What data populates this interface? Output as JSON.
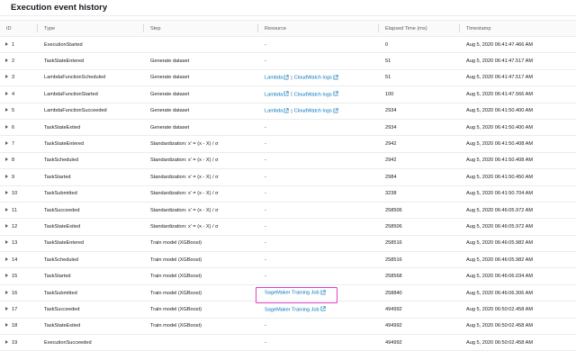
{
  "panel": {
    "title": "Execution event history"
  },
  "columns": [
    "ID",
    "Type",
    "Step",
    "Resource",
    "Elapsed Time (ms)",
    "Timestamp"
  ],
  "rows": [
    {
      "id": "1",
      "type": "ExecutionStarted",
      "step": "",
      "resource": {
        "kind": "dash",
        "text": "-"
      },
      "elapsed": "0",
      "timestamp": "Aug 5, 2020 06:41:47.466 AM"
    },
    {
      "id": "2",
      "type": "TaskStateEntered",
      "step": "Generate dataset",
      "resource": {
        "kind": "dash",
        "text": "-"
      },
      "elapsed": "51",
      "timestamp": "Aug 5, 2020 06:41:47.517 AM"
    },
    {
      "id": "3",
      "type": "LambdaFunctionScheduled",
      "step": "Generate dataset",
      "resource": {
        "kind": "lambda",
        "lambda": "Lambda",
        "cw": "CloudWatch logs"
      },
      "elapsed": "51",
      "timestamp": "Aug 5, 2020 06:41:47.517 AM"
    },
    {
      "id": "4",
      "type": "LambdaFunctionStarted",
      "step": "Generate dataset",
      "resource": {
        "kind": "lambda",
        "lambda": "Lambda",
        "cw": "CloudWatch logs"
      },
      "elapsed": "100",
      "timestamp": "Aug 5, 2020 06:41:47.566 AM"
    },
    {
      "id": "5",
      "type": "LambdaFunctionSucceeded",
      "step": "Generate dataset",
      "resource": {
        "kind": "lambda",
        "lambda": "Lambda",
        "cw": "CloudWatch logs"
      },
      "elapsed": "2934",
      "timestamp": "Aug 5, 2020 06:41:50.400 AM"
    },
    {
      "id": "6",
      "type": "TaskStateExited",
      "step": "Generate dataset",
      "resource": {
        "kind": "dash",
        "text": "-"
      },
      "elapsed": "2934",
      "timestamp": "Aug 5, 2020 06:41:50.400 AM"
    },
    {
      "id": "7",
      "type": "TaskStateEntered",
      "step": "Standardization: x' = (x - X) / σ",
      "resource": {
        "kind": "dash",
        "text": "-"
      },
      "elapsed": "2942",
      "timestamp": "Aug 5, 2020 06:41:50.408 AM"
    },
    {
      "id": "8",
      "type": "TaskScheduled",
      "step": "Standardization: x' = (x - X) / σ",
      "resource": {
        "kind": "dash",
        "text": "-"
      },
      "elapsed": "2942",
      "timestamp": "Aug 5, 2020 06:41:50.408 AM"
    },
    {
      "id": "9",
      "type": "TaskStarted",
      "step": "Standardization: x' = (x - X) / σ",
      "resource": {
        "kind": "dash",
        "text": "-"
      },
      "elapsed": "2984",
      "timestamp": "Aug 5, 2020 06:41:50.450 AM"
    },
    {
      "id": "10",
      "type": "TaskSubmitted",
      "step": "Standardization: x' = (x - X) / σ",
      "resource": {
        "kind": "dash",
        "text": "-"
      },
      "elapsed": "3238",
      "timestamp": "Aug 5, 2020 06:41:50.704 AM"
    },
    {
      "id": "11",
      "type": "TaskSucceeded",
      "step": "Standardization: x' = (x - X) / σ",
      "resource": {
        "kind": "dash",
        "text": "-"
      },
      "elapsed": "258506",
      "timestamp": "Aug 5, 2020 06:46:05.972 AM"
    },
    {
      "id": "12",
      "type": "TaskStateExited",
      "step": "Standardization: x' = (x - X) / σ",
      "resource": {
        "kind": "dash",
        "text": "-"
      },
      "elapsed": "258506",
      "timestamp": "Aug 5, 2020 06:46:05.972 AM"
    },
    {
      "id": "13",
      "type": "TaskStateEntered",
      "step": "Train model (XGBoost)",
      "resource": {
        "kind": "dash",
        "text": "-"
      },
      "elapsed": "258516",
      "timestamp": "Aug 5, 2020 06:46:05.982 AM"
    },
    {
      "id": "14",
      "type": "TaskScheduled",
      "step": "Train model (XGBoost)",
      "resource": {
        "kind": "dash",
        "text": "-"
      },
      "elapsed": "258516",
      "timestamp": "Aug 5, 2020 06:46:05.982 AM"
    },
    {
      "id": "15",
      "type": "TaskStarted",
      "step": "Train model (XGBoost)",
      "resource": {
        "kind": "dash",
        "text": "-"
      },
      "elapsed": "258568",
      "timestamp": "Aug 5, 2020 06:46:06.034 AM"
    },
    {
      "id": "16",
      "type": "TaskSubmitted",
      "step": "Train model (XGBoost)",
      "resource": {
        "kind": "link",
        "text": "SageMaker Training Job"
      },
      "elapsed": "258840",
      "timestamp": "Aug 5, 2020 06:46:06.306 AM"
    },
    {
      "id": "17",
      "type": "TaskSucceeded",
      "step": "Train model (XGBoost)",
      "resource": {
        "kind": "link",
        "text": "SageMaker Training Job"
      },
      "elapsed": "494992",
      "timestamp": "Aug 5, 2020 06:50:02.458 AM"
    },
    {
      "id": "18",
      "type": "TaskStateExited",
      "step": "Train model (XGBoost)",
      "resource": {
        "kind": "dash",
        "text": "-"
      },
      "elapsed": "494992",
      "timestamp": "Aug 5, 2020 06:50:02.458 AM"
    },
    {
      "id": "19",
      "type": "ExecutionSucceeded",
      "step": "",
      "resource": {
        "kind": "dash",
        "text": "-"
      },
      "elapsed": "494992",
      "timestamp": "Aug 5, 2020 06:50:02.458 AM"
    }
  ],
  "colors": {
    "link": "#0073bb",
    "highlight": "#e040c8",
    "header_bg": "#fafafa",
    "border": "#eaeded"
  }
}
